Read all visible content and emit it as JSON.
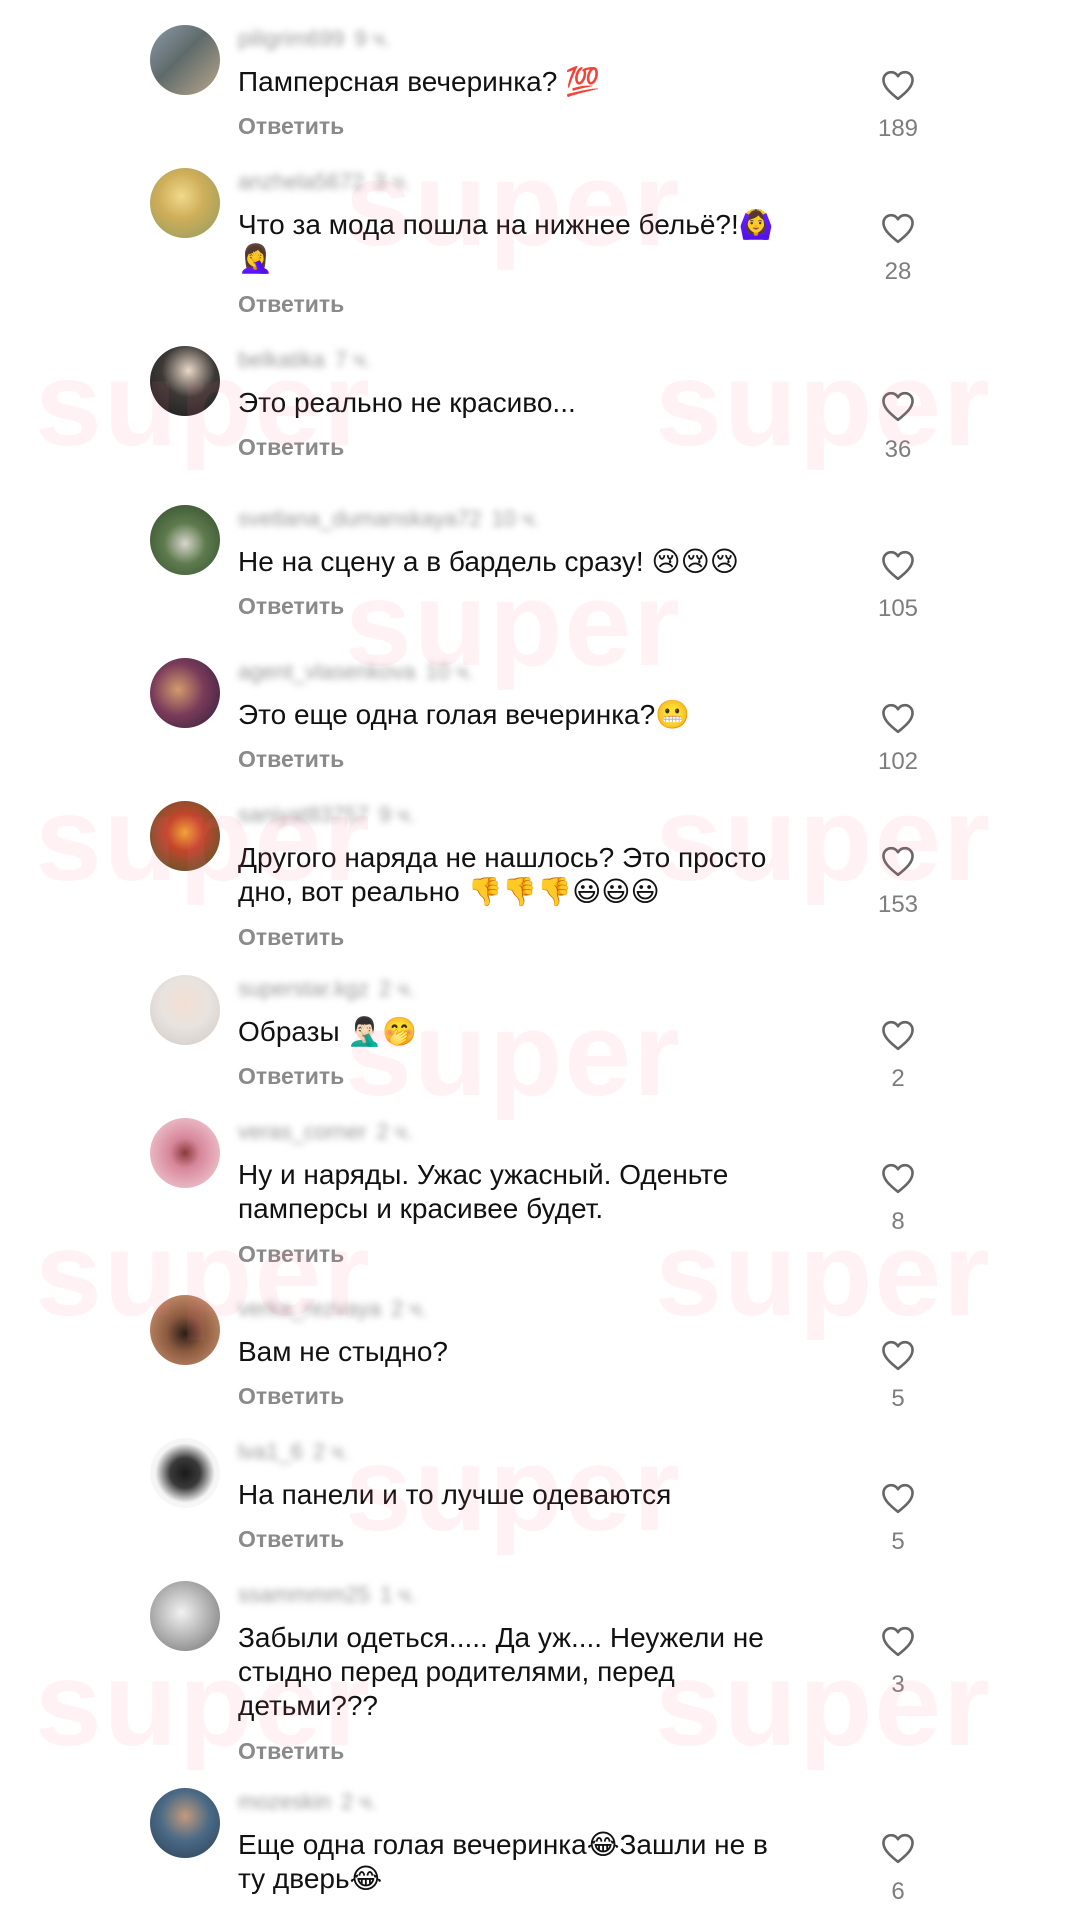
{
  "reply_label": "Ответить",
  "watermark_text": "super",
  "colors": {
    "text": "#111111",
    "muted": "#8a8a8a",
    "watermark": "#ff6b8e"
  },
  "comments": [
    {
      "username": "piligrim699",
      "time": "9 ч.",
      "text": "Памперсная вечеринка? 💯",
      "likes": "189"
    },
    {
      "username": "anzhela5672",
      "time": "3 ч.",
      "text": "Что за мода пошла на нижнее бельё?!🙆‍♀️\n🤦‍♀️",
      "likes": "28"
    },
    {
      "username": "belkatika",
      "time": "7 ч.",
      "text": "Это реально не красиво...",
      "likes": "36"
    },
    {
      "username": "svetlana_dumanskaya72",
      "time": "10 ч.",
      "text": "Не на сцену а в бардель сразу! 😢😢😢",
      "likes": "105"
    },
    {
      "username": "agent_vlasenkova",
      "time": "10 ч.",
      "text": "Это еще одна голая вечеринка?😬",
      "likes": "102"
    },
    {
      "username": "saniyat83757",
      "time": "9 ч.",
      "text": "Другого наряда не нашлось? Это просто\nдно, вот реально 👎👎👎😃😃😃",
      "likes": "153"
    },
    {
      "username": "superstar.kgz",
      "time": "2 ч.",
      "text": "Образы 🤦🏻‍♂️🤭",
      "likes": "2"
    },
    {
      "username": "veras_corner",
      "time": "2 ч.",
      "text": "Ну и наряды. Ужас ужасный. Оденьте\nпамперсы и красивее будет.",
      "likes": "8"
    },
    {
      "username": "verka_rezvaya",
      "time": "2 ч.",
      "text": "Вам не стыдно?",
      "likes": "5"
    },
    {
      "username": "lva1_6",
      "time": "2 ч.",
      "text": "На панели и то лучше одеваются",
      "likes": "5"
    },
    {
      "username": "ssammmm25",
      "time": "1 ч.",
      "text": "Забыли одеться..... Да уж.... Неужели не\nстыдно перед родителями, перед\nдетьми???",
      "likes": "3"
    },
    {
      "username": "mozeskin",
      "time": "2 ч.",
      "text": "Еще одна голая вечеринка😂Зашли не в\nту дверь😂",
      "likes": "6"
    }
  ]
}
